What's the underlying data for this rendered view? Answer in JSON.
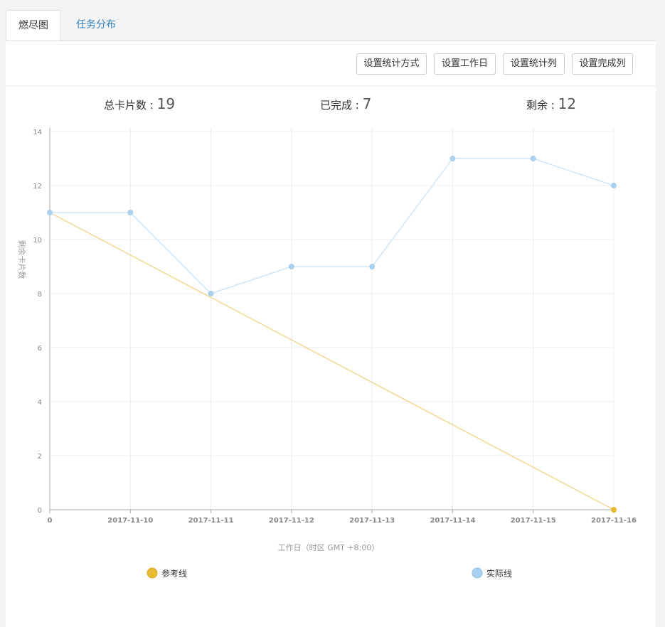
{
  "tabs": [
    {
      "label": "燃尽图"
    },
    {
      "label": "任务分布"
    }
  ],
  "toolbar": {
    "buttons": [
      "设置统计方式",
      "设置工作日",
      "设置统计列",
      "设置完成列"
    ]
  },
  "stats": {
    "total_label": "总卡片数 :",
    "total_value": "19",
    "done_label": "已完成 :",
    "done_value": "7",
    "remaining_label": "剩余 :",
    "remaining_value": "12"
  },
  "chart_data": {
    "type": "line",
    "xlabel": "工作日（时区 GMT +8:00）",
    "ylabel": "剩余卡片数",
    "categories": [
      "0",
      "2017-11-10",
      "2017-11-11",
      "2017-11-12",
      "2017-11-13",
      "2017-11-14",
      "2017-11-15",
      "2017-11-16"
    ],
    "ylim": [
      0,
      14
    ],
    "yticks": [
      0,
      2,
      4,
      6,
      8,
      10,
      12,
      14
    ],
    "grid": true,
    "legend": "bottom",
    "series": [
      {
        "name": "参考线",
        "color": "#e8b931",
        "line_color": "#f0d990",
        "values": [
          11,
          null,
          null,
          null,
          null,
          null,
          null,
          0
        ]
      },
      {
        "name": "实际线",
        "color": "#a9d0ee",
        "line_color": "#cfe6f6",
        "values": [
          11,
          11,
          8,
          9,
          9,
          13,
          13,
          12
        ]
      }
    ]
  }
}
